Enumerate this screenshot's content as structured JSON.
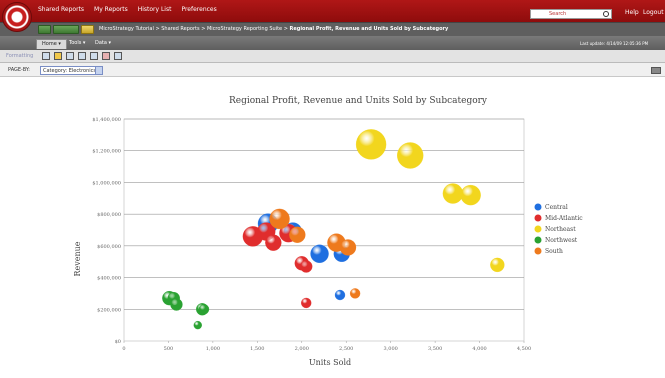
{
  "header": {
    "nav": [
      "Shared Reports",
      "My Reports",
      "History List",
      "Preferences"
    ],
    "search_placeholder": "Search",
    "help": "Help",
    "logout": "Logout"
  },
  "breadcrumb": {
    "parts": [
      "MicroStrategy Tutorial",
      "Shared Reports",
      "MicroStrategy Reporting Suite"
    ],
    "current": "Regional Profit, Revenue and Units Sold by Subcategory"
  },
  "tabs": [
    "Home",
    "Tools",
    "Data"
  ],
  "last_update": "Last update: 4/14/09 12:05:36 PM",
  "toolbar": {
    "label": "Formatting"
  },
  "page_by": {
    "label": "PAGE-BY:",
    "selected": "Category: Electronics"
  },
  "chart_data": {
    "type": "scatter",
    "title": "Regional Profit, Revenue and Units Sold by Subcategory",
    "xlabel": "Units Sold",
    "ylabel": "Revenue",
    "xlim": [
      0,
      4500
    ],
    "ylim": [
      0,
      1400000
    ],
    "xticks": [
      "0",
      "500",
      "1,000",
      "1,500",
      "2,000",
      "2,500",
      "3,000",
      "3,500",
      "4,000",
      "4,500"
    ],
    "yticks": [
      "$0",
      "$200,000",
      "$400,000",
      "$600,000",
      "$800,000",
      "$1,000,000",
      "$1,200,000",
      "$1,400,000"
    ],
    "legend_position": "right",
    "series": [
      {
        "name": "Central",
        "color": "#1f6fe0",
        "points": [
          [
            1620,
            740000,
            10
          ],
          [
            1900,
            690000,
            9
          ],
          [
            2200,
            550000,
            9
          ],
          [
            2450,
            550000,
            8
          ],
          [
            2430,
            290000,
            5
          ]
        ]
      },
      {
        "name": "Mid-Atlantic",
        "color": "#e02d2d",
        "points": [
          [
            1450,
            660000,
            10
          ],
          [
            1600,
            690000,
            9
          ],
          [
            1680,
            620000,
            8
          ],
          [
            1850,
            680000,
            9
          ],
          [
            2000,
            490000,
            7
          ],
          [
            2050,
            470000,
            6
          ],
          [
            2050,
            240000,
            5
          ]
        ]
      },
      {
        "name": "Northeast",
        "color": "#f2d61e",
        "points": [
          [
            2780,
            1240000,
            15
          ],
          [
            3220,
            1170000,
            13
          ],
          [
            3700,
            930000,
            10
          ],
          [
            3900,
            920000,
            10
          ],
          [
            4200,
            480000,
            7
          ]
        ]
      },
      {
        "name": "Northwest",
        "color": "#2aa232",
        "points": [
          [
            510,
            270000,
            7
          ],
          [
            560,
            270000,
            6
          ],
          [
            590,
            230000,
            6
          ],
          [
            880,
            200000,
            6
          ],
          [
            900,
            200000,
            5
          ],
          [
            830,
            100000,
            4
          ]
        ]
      },
      {
        "name": "South",
        "color": "#ee7a1d",
        "points": [
          [
            1750,
            770000,
            10
          ],
          [
            1950,
            670000,
            8
          ],
          [
            2390,
            620000,
            9
          ],
          [
            2520,
            590000,
            8
          ],
          [
            2600,
            300000,
            5
          ]
        ]
      }
    ]
  }
}
